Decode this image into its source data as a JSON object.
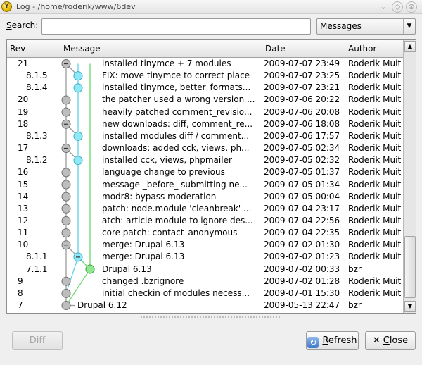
{
  "window": {
    "icon_letter": "Y",
    "title": "Log - /home/roderik/www/6dev",
    "buttons": [
      "⌄",
      "◇",
      "⊗"
    ]
  },
  "search": {
    "label_prefix": "S",
    "label_rest": "earch:",
    "value": "",
    "placeholder": "",
    "filter_selected": "Messages",
    "filter_arrow": "▼"
  },
  "table": {
    "columns": [
      "Rev",
      "Message",
      "Date",
      "Author"
    ],
    "rows": [
      {
        "rev": "21",
        "message": "installed tinymce + 7 modules",
        "date": "2009-07-07 23:49",
        "author": "Roderik Muit"
      },
      {
        "rev": "8.1.5",
        "message": "FIX: move tinymce to correct place",
        "date": "2009-07-07 23:25",
        "author": "Roderik Muit"
      },
      {
        "rev": "8.1.4",
        "message": "installed tinymce, better_formats...",
        "date": "2009-07-07 23:21",
        "author": "Roderik Muit"
      },
      {
        "rev": "20",
        "message": "the patcher used a wrong version ...",
        "date": "2009-07-06 20:22",
        "author": "Roderik Muit"
      },
      {
        "rev": "19",
        "message": "heavily patched comment_revisio...",
        "date": "2009-07-06 20:08",
        "author": "Roderik Muit"
      },
      {
        "rev": "18",
        "message": "new downloads: diff, comment_re...",
        "date": "2009-07-06 18:08",
        "author": "Roderik Muit"
      },
      {
        "rev": "8.1.3",
        "message": "installed modules diff / comment...",
        "date": "2009-07-06 17:57",
        "author": "Roderik Muit"
      },
      {
        "rev": "17",
        "message": "downloads: added cck, views, ph...",
        "date": "2009-07-05 02:34",
        "author": "Roderik Muit"
      },
      {
        "rev": "8.1.2",
        "message": "installed cck, views, phpmailer",
        "date": "2009-07-05 02:32",
        "author": "Roderik Muit"
      },
      {
        "rev": "16",
        "message": "language change to previous",
        "date": "2009-07-05 01:37",
        "author": "Roderik Muit"
      },
      {
        "rev": "15",
        "message": "message _before_ submitting ne...",
        "date": "2009-07-05 01:34",
        "author": "Roderik Muit"
      },
      {
        "rev": "14",
        "message": "modr8: bypass moderation",
        "date": "2009-07-05 00:04",
        "author": "Roderik Muit"
      },
      {
        "rev": "13",
        "message": "patch: node.module 'cleanbreak' ...",
        "date": "2009-07-04 23:17",
        "author": "Roderik Muit"
      },
      {
        "rev": "12",
        "message": "atch: article module to ignore des...",
        "date": "2009-07-04 22:56",
        "author": "Roderik Muit"
      },
      {
        "rev": "11",
        "message": "core patch: contact_anonymous",
        "date": "2009-07-04 22:35",
        "author": "Roderik Muit"
      },
      {
        "rev": "10",
        "message": "merge: Drupal 6.13",
        "date": "2009-07-02 01:30",
        "author": "Roderik Muit"
      },
      {
        "rev": "8.1.1",
        "message": "merge: Drupal 6.13",
        "date": "2009-07-02 01:23",
        "author": "Roderik Muit"
      },
      {
        "rev": "7.1.1",
        "message": "Drupal 6.13",
        "date": "2009-07-02 00:33",
        "author": "bzr"
      },
      {
        "rev": "9",
        "message": "changed .bzrignore",
        "date": "2009-07-02 01:28",
        "author": "Roderik Muit"
      },
      {
        "rev": "8",
        "message": "initial checkin of modules necess...",
        "date": "2009-07-01 15:30",
        "author": "Roderik Muit"
      },
      {
        "rev": "7",
        "message": "Drupal 6.12",
        "date": "2009-05-13 22:47",
        "author": "bzr"
      }
    ]
  },
  "graph_colors": {
    "mainline": "#9a9a9a",
    "branch": "#5fd0e8",
    "vendor": "#6ad86a",
    "node_gray": "#bdbdbd",
    "node_cyan": "#8fe8f6",
    "node_green": "#8ee88e"
  },
  "scrollbar": {
    "up": "▲",
    "down": "▼"
  },
  "buttons": {
    "diff": "Diff",
    "refresh_icon": "↻",
    "refresh_mnemonic": "R",
    "refresh_rest": "efresh",
    "close_icon": "✕",
    "close_mnemonic": "C",
    "close_rest": "lose"
  }
}
